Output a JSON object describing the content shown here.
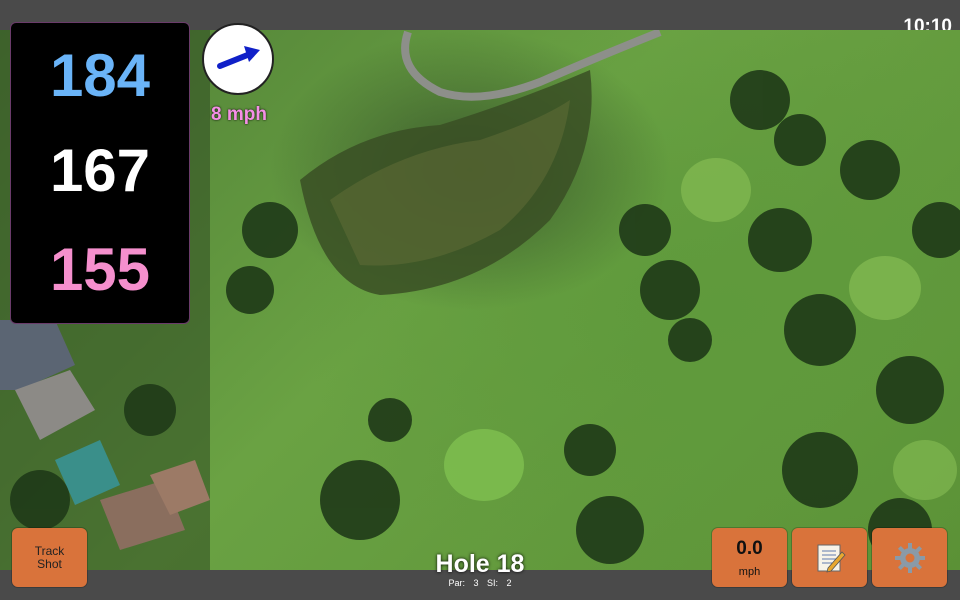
{
  "status": {
    "time": "10:10"
  },
  "distances": {
    "back": "184",
    "middle": "167",
    "front": "155"
  },
  "wind": {
    "speed": "8 mph",
    "icon": "wind-direction-arrow-icon",
    "direction": "east-northeast"
  },
  "hole": {
    "title": "Hole 18",
    "par": "Par: 3",
    "si": "SI: 2"
  },
  "buttons": {
    "track_shot": "Track\nShot",
    "speed_value": "0.0",
    "speed_unit": "mph",
    "notes_icon": "notepad-icon",
    "settings_icon": "gear-icon"
  },
  "colors": {
    "back_distance": "#6ab4f8",
    "middle_distance": "#ffffff",
    "front_distance": "#f58fcd",
    "button": "#d9733b",
    "wind_text": "#f58fe6"
  }
}
